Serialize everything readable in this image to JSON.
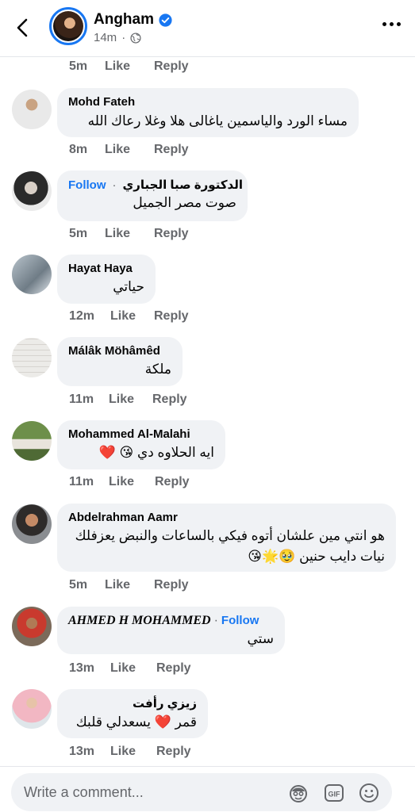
{
  "header": {
    "name": "Angham",
    "time": "14m"
  },
  "top_actions": {
    "time": "5m",
    "like": "Like",
    "reply": "Reply"
  },
  "comments": [
    {
      "name": "Mohd Fateh",
      "text": "مساء الورد والياسمين  ياغالى هلا وغلا  رعاك الله",
      "time": "8m",
      "like": "Like",
      "reply": "Reply"
    },
    {
      "name": "الدكتورة  صبا الجباري",
      "follow": "Follow",
      "text": "صوت مصر الجميل",
      "time": "5m",
      "like": "Like",
      "reply": "Reply"
    },
    {
      "name": "Hayat Haya",
      "text": "حياتي",
      "time": "12m",
      "like": "Like",
      "reply": "Reply"
    },
    {
      "name": "Málâk Möhâmêd",
      "text": "ملكة",
      "time": "11m",
      "like": "Like",
      "reply": "Reply"
    },
    {
      "name": "Mohammed Al-Malahi",
      "text": "ايه الحلاوه دي 😘 ❤️",
      "time": "11m",
      "like": "Like",
      "reply": "Reply"
    },
    {
      "name": "Abdelrahman Aamr",
      "text_line1": "هو انتي مين علشان أتوه فيكي بالساعات والنبض يعزفلك",
      "text_line2": "نيات دايب حنين 🥹🌟😘",
      "time": "5m",
      "like": "Like",
      "reply": "Reply"
    },
    {
      "name": "AHMED H MOHAMMED",
      "follow": "Follow",
      "text": "ستي",
      "time": "13m",
      "like": "Like",
      "reply": "Reply"
    },
    {
      "name": "زيزي رأفت",
      "text": "قمر ❤️ يسعدلي قلبك",
      "time": "13m",
      "like": "Like",
      "reply": "Reply"
    }
  ],
  "composer": {
    "placeholder": "Write a comment..."
  },
  "colors": {
    "accent": "#1877f2",
    "bubble": "#f0f2f5",
    "secondary_text": "#65676b"
  }
}
